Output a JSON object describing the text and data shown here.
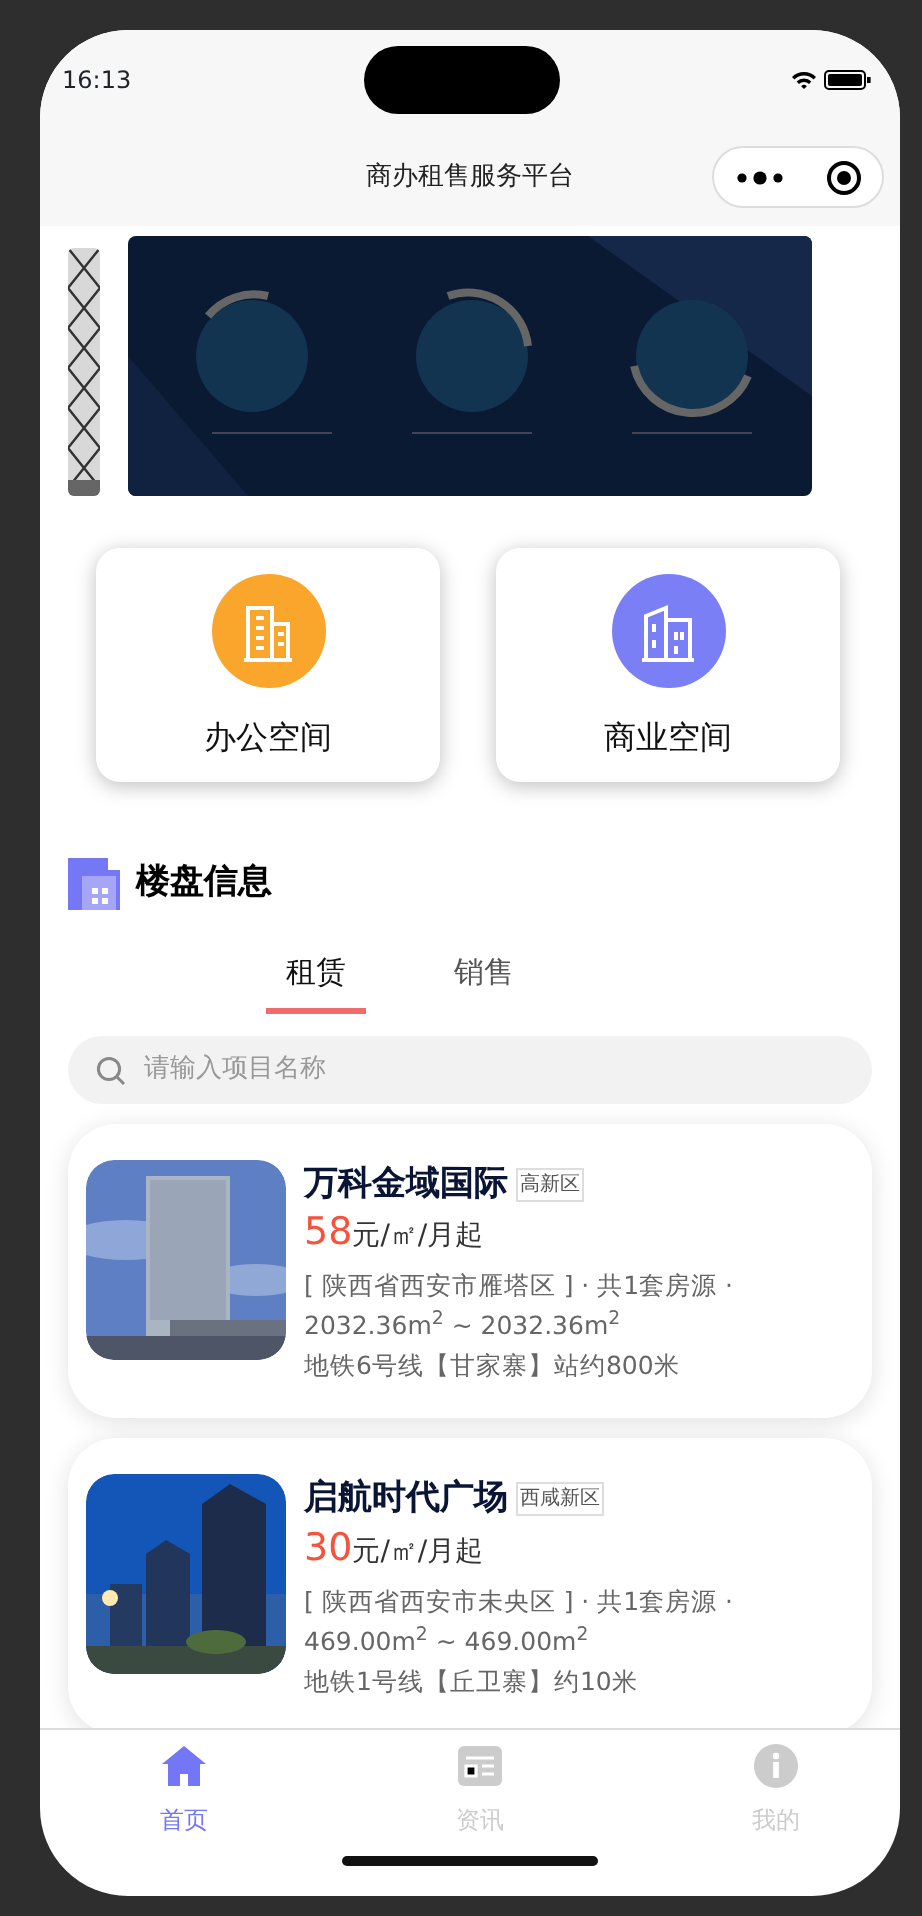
{
  "status_bar": {
    "time": "16:13"
  },
  "nav": {
    "title": "商办租售服务平台"
  },
  "categories": [
    {
      "label": "办公空间",
      "color": "#faa62c"
    },
    {
      "label": "商业空间",
      "color": "#7b7ff6"
    }
  ],
  "section": {
    "title": "楼盘信息"
  },
  "tabs": [
    {
      "label": "租赁",
      "selected": true
    },
    {
      "label": "销售",
      "selected": false
    }
  ],
  "search": {
    "placeholder": "请输入项目名称"
  },
  "listings": [
    {
      "name": "万科金域国际",
      "district": "高新区",
      "price": "58",
      "unit": "元/㎡/月起",
      "location": "[ 陕西省西安市雁塔区 ] · 共1套房源 ·",
      "area": "2032.36m$^{2}$ ~ 2032.36m$^{2}$",
      "transit": "地铁6号线【甘家寨】站约800米"
    },
    {
      "name": "启航时代广场",
      "district": "西咸新区",
      "price": "30",
      "unit": "元/㎡/月起",
      "location": "[ 陕西省西安市未央区 ] · 共1套房源 ·",
      "area": "469.00m$^{2}$ ~ 469.00m$^{2}$",
      "transit": "地铁1号线【丘卫寨】约10米"
    }
  ],
  "tabbar": [
    {
      "label": "首页",
      "selected": true,
      "kind": "home"
    },
    {
      "label": "资讯",
      "selected": false,
      "kind": "news"
    },
    {
      "label": "我的",
      "selected": false,
      "kind": "info"
    }
  ]
}
